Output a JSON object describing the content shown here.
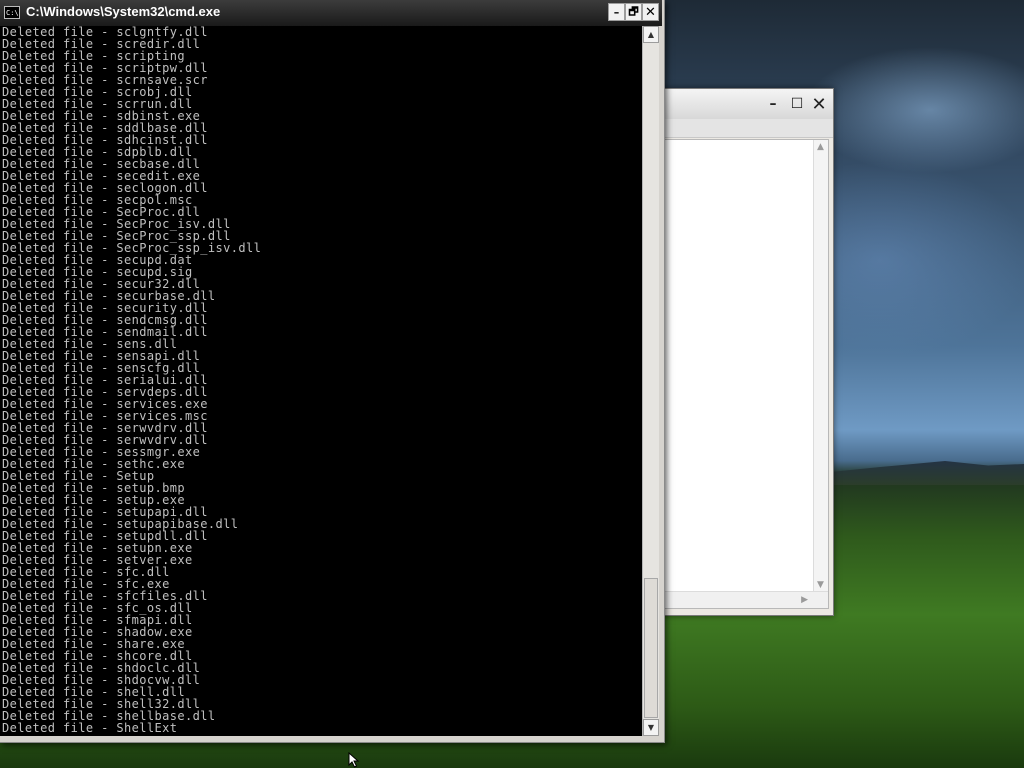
{
  "cmd": {
    "title": "C:\\Windows\\System32\\cmd.exe",
    "icon_label": "C:\\",
    "buttons": {
      "minimize": "–",
      "restore": "🗗",
      "close": "✕"
    },
    "lines": [
      "Deleted file - sclgntfy.dll",
      "Deleted file - scredir.dll",
      "Deleted file - scripting",
      "Deleted file - scriptpw.dll",
      "Deleted file - scrnsave.scr",
      "Deleted file - scrobj.dll",
      "Deleted file - scrrun.dll",
      "Deleted file - sdbinst.exe",
      "Deleted file - sddlbase.dll",
      "Deleted file - sdhcinst.dll",
      "Deleted file - sdpblb.dll",
      "Deleted file - secbase.dll",
      "Deleted file - secedit.exe",
      "Deleted file - seclogon.dll",
      "Deleted file - secpol.msc",
      "Deleted file - SecProc.dll",
      "Deleted file - SecProc_isv.dll",
      "Deleted file - SecProc_ssp.dll",
      "Deleted file - SecProc_ssp_isv.dll",
      "Deleted file - secupd.dat",
      "Deleted file - secupd.sig",
      "Deleted file - secur32.dll",
      "Deleted file - securbase.dll",
      "Deleted file - security.dll",
      "Deleted file - sendcmsg.dll",
      "Deleted file - sendmail.dll",
      "Deleted file - sens.dll",
      "Deleted file - sensapi.dll",
      "Deleted file - senscfg.dll",
      "Deleted file - serialui.dll",
      "Deleted file - servdeps.dll",
      "Deleted file - services.exe",
      "Deleted file - services.msc",
      "Deleted file - serwvdrv.dll",
      "Deleted file - serwvdrv.dll",
      "Deleted file - sessmgr.exe",
      "Deleted file - sethc.exe",
      "Deleted file - Setup",
      "Deleted file - setup.bmp",
      "Deleted file - setup.exe",
      "Deleted file - setupapi.dll",
      "Deleted file - setupapibase.dll",
      "Deleted file - setupdll.dll",
      "Deleted file - setupn.exe",
      "Deleted file - setver.exe",
      "Deleted file - sfc.dll",
      "Deleted file - sfc.exe",
      "Deleted file - sfcfiles.dll",
      "Deleted file - sfc_os.dll",
      "Deleted file - sfmapi.dll",
      "Deleted file - shadow.exe",
      "Deleted file - share.exe",
      "Deleted file - shcore.dll",
      "Deleted file - shdoclc.dll",
      "Deleted file - shdocvw.dll",
      "Deleted file - shell.dll",
      "Deleted file - shell32.dll",
      "Deleted file - shellbase.dll",
      "Deleted file - ShellExt"
    ]
  },
  "background_window": {
    "buttons": {
      "minimize": "–",
      "maximize": "☐",
      "close": "✕"
    }
  },
  "colors": {
    "console_bg": "#000000",
    "console_text": "#c0c0c0",
    "titlebar": "#1a1a1a"
  }
}
